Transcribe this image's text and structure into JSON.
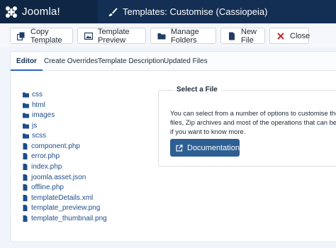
{
  "header": {
    "brand_name": "Joomla!",
    "page_title": "Templates: Customise (Cassiopeia)"
  },
  "toolbar": {
    "copy_template": "Copy Template",
    "template_preview": "Template Preview",
    "manage_folders": "Manage Folders",
    "new_file": "New File",
    "close": "Close"
  },
  "tabs": [
    "Editor",
    "Create Overrides",
    "Template Description",
    "Updated Files"
  ],
  "tree": {
    "folders": [
      "css",
      "html",
      "images",
      "js",
      "scss"
    ],
    "files": [
      "component.php",
      "error.php",
      "index.php",
      "joomla.asset.json",
      "offline.php",
      "templateDetails.xml",
      "template_preview.png",
      "template_thumbnail.png"
    ]
  },
  "select_file": {
    "legend": "Select a File",
    "line1": "You can select from a number of options to customise the look o",
    "line2": "files, Zip archives and most of the operations that can be perfor",
    "line3": "if you want to know more.",
    "documentation_label": "Documentation"
  },
  "colors": {
    "header_bg": "#132f53",
    "brand_bg": "#0f2744",
    "link": "#1e4d8b",
    "primary_button": "#2e5f93",
    "close_icon": "#c52a2a",
    "page_bg": "#f0f4fb"
  }
}
